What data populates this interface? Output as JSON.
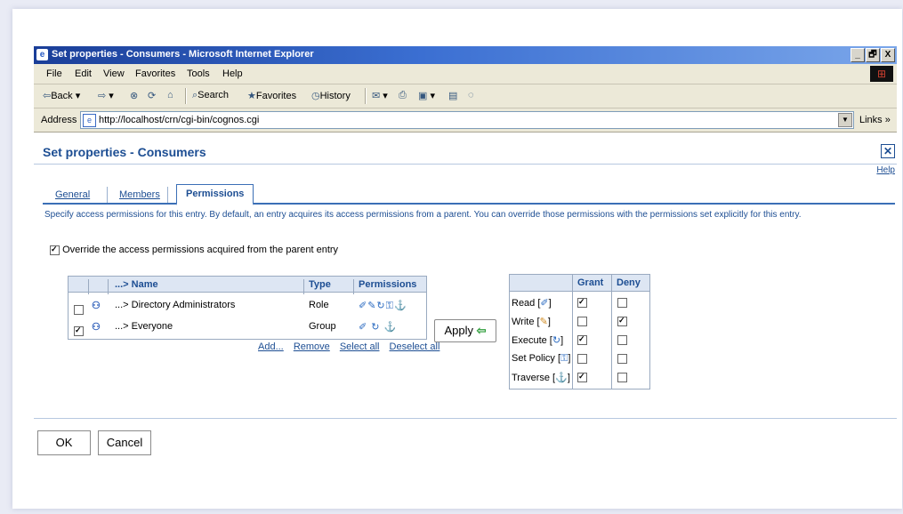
{
  "window": {
    "title": "Set properties - Consumers - Microsoft Internet Explorer",
    "controls": {
      "minimize": "_",
      "maximize": "🗗",
      "close": "X"
    }
  },
  "menu": [
    "File",
    "Edit",
    "View",
    "Favorites",
    "Tools",
    "Help"
  ],
  "toolbar": {
    "back": "Back",
    "search": "Search",
    "favorites": "Favorites",
    "history": "History"
  },
  "address": {
    "label": "Address",
    "url": "http://localhost/crn/cgi-bin/cognos.cgi",
    "links": "Links »"
  },
  "page": {
    "title": "Set properties - Consumers",
    "help": "Help",
    "tabs": [
      "General",
      "Members",
      "Permissions"
    ],
    "active_tab": "Permissions",
    "description": "Specify access permissions for this entry. By default, an entry acquires its access permissions from a parent. You can override those permissions with the permissions set explicitly for this entry.",
    "override_label": "Override the access permissions acquired from the parent entry",
    "override_checked": true
  },
  "entries": {
    "headers": {
      "name": "...> Name",
      "type": "Type",
      "permissions": "Permissions"
    },
    "rows": [
      {
        "name": "...> Directory Administrators",
        "type": "Role",
        "checked": false
      },
      {
        "name": "...> Everyone",
        "type": "Group",
        "checked": true
      }
    ],
    "actions": [
      "Add...",
      "Remove",
      "Select all",
      "Deselect all"
    ]
  },
  "apply_label": "Apply",
  "grants": {
    "headers": {
      "grant": "Grant",
      "deny": "Deny"
    },
    "rows": [
      {
        "label": "Read",
        "grant": true,
        "deny": false
      },
      {
        "label": "Write",
        "grant": false,
        "deny": true
      },
      {
        "label": "Execute",
        "grant": true,
        "deny": false
      },
      {
        "label": "Set Policy",
        "grant": false,
        "deny": false
      },
      {
        "label": "Traverse",
        "grant": true,
        "deny": false
      }
    ]
  },
  "buttons": {
    "ok": "OK",
    "cancel": "Cancel"
  }
}
